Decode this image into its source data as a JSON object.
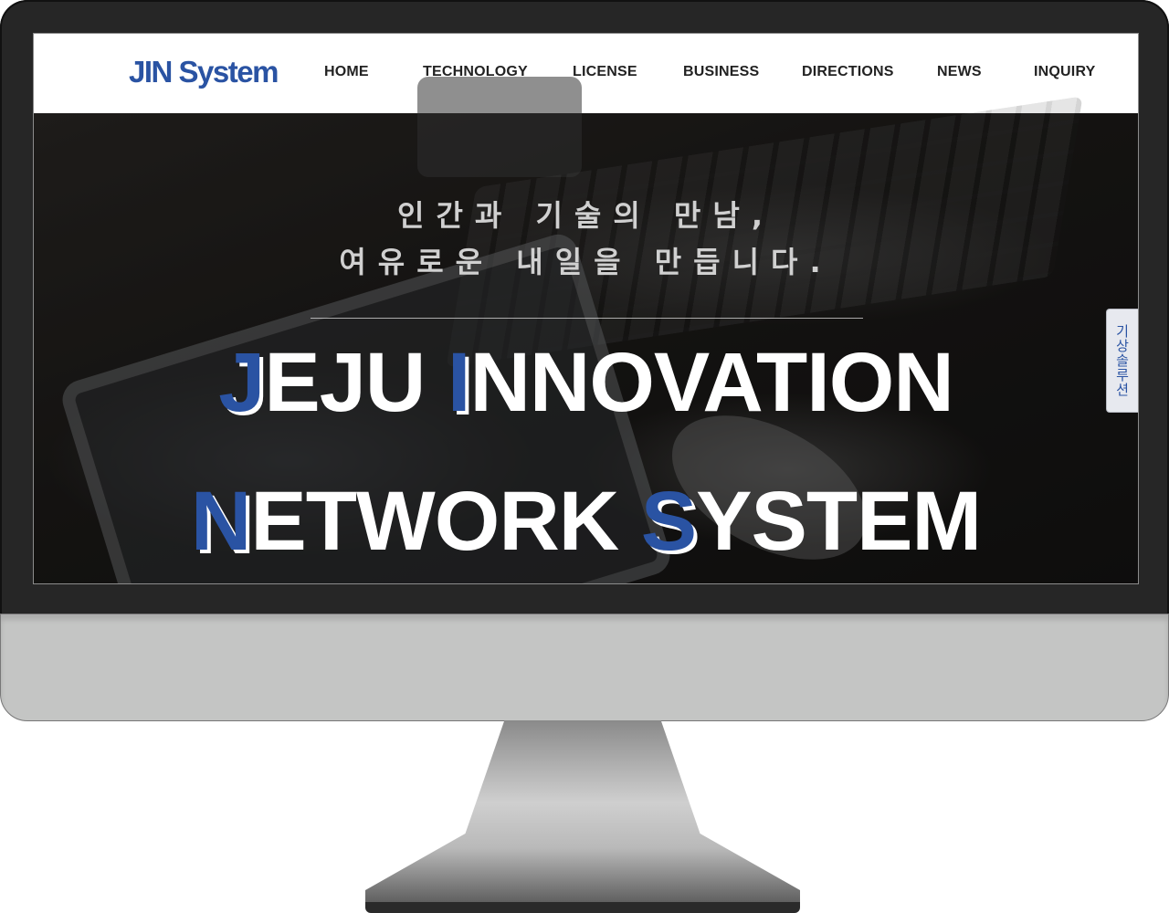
{
  "brand": {
    "logo_text": "JIN System",
    "accent_color": "#2a53a3"
  },
  "nav": {
    "items": [
      {
        "label": "HOME"
      },
      {
        "label": "TECHNOLOGY"
      },
      {
        "label": "LICENSE"
      },
      {
        "label": "BUSINESS"
      },
      {
        "label": "DIRECTIONS"
      },
      {
        "label": "NEWS"
      },
      {
        "label": "INQUIRY"
      }
    ]
  },
  "hero": {
    "tagline_line1": "인간과 기술의 만남,",
    "tagline_line2": "여유로운 내일을 만듭니다.",
    "headline_line1": {
      "w1_initial": "J",
      "w1_rest": "EJU ",
      "w2_initial": "I",
      "w2_rest": "NNOVATION"
    },
    "headline_line2": {
      "w1_initial": "N",
      "w1_rest": "ETWORK ",
      "w2_initial": "S",
      "w2_rest": "YSTEM"
    }
  },
  "side_tab": {
    "label": "기상솔루션"
  },
  "colors": {
    "bezel": "#262626",
    "chin": "#c4c5c4",
    "headline": "#ffffff"
  }
}
